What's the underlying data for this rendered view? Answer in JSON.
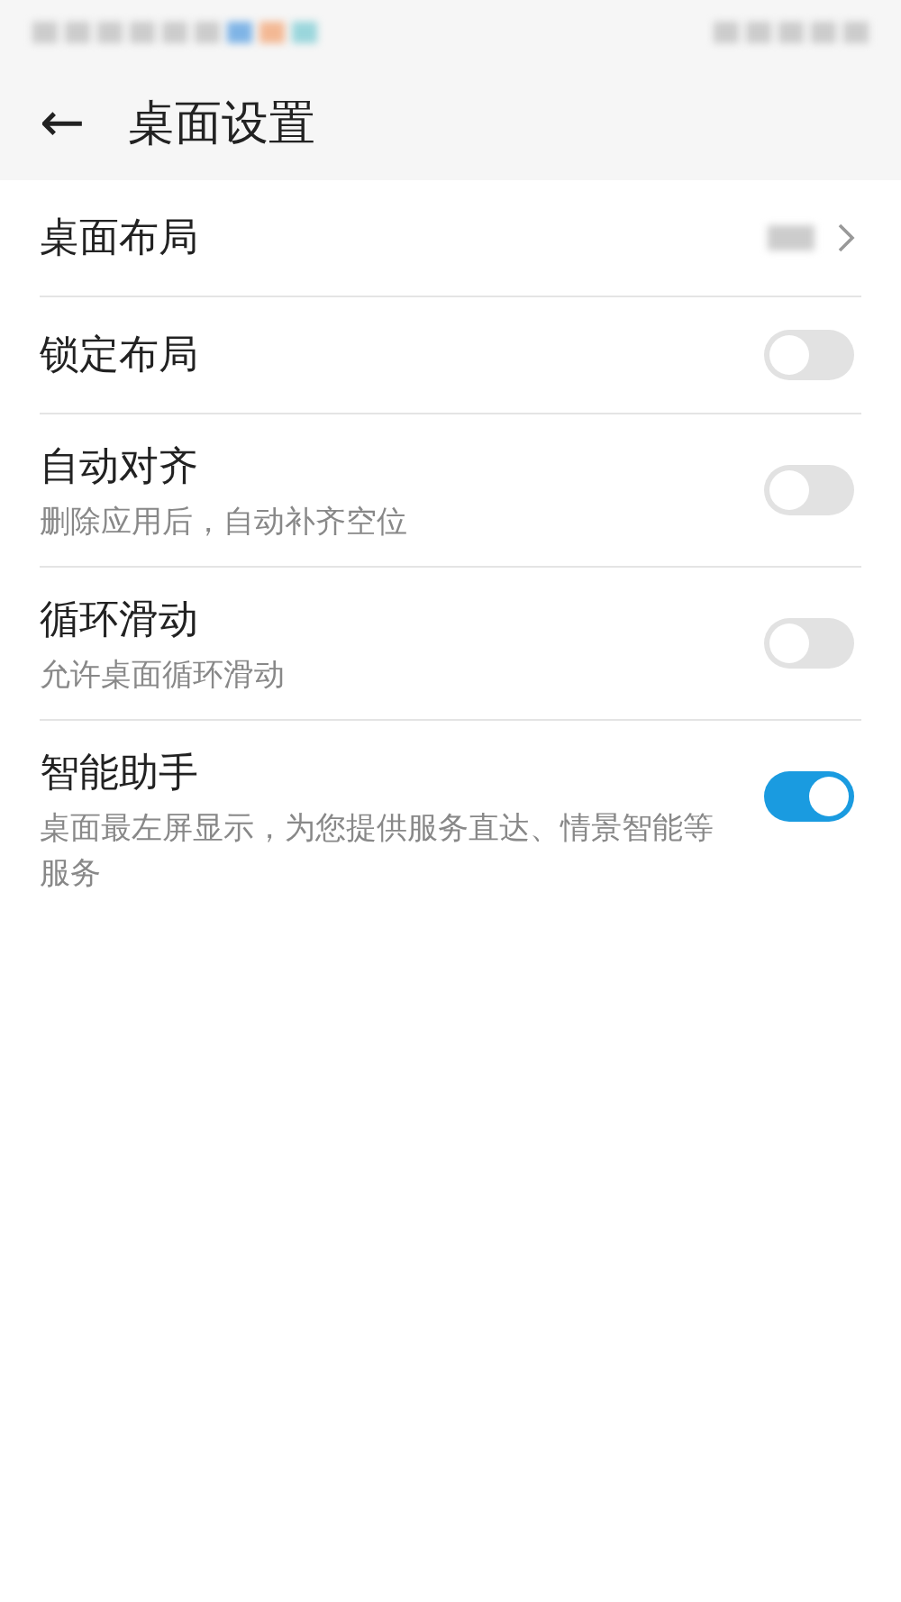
{
  "header": {
    "back_icon": "←",
    "title": "桌面设置"
  },
  "rows": [
    {
      "kind": "link",
      "title": "桌面布局"
    },
    {
      "kind": "switch",
      "title": "锁定布局",
      "on": false
    },
    {
      "kind": "switch",
      "title": "自动对齐",
      "subtitle": "删除应用后，自动补齐空位",
      "on": false
    },
    {
      "kind": "switch",
      "title": "循环滑动",
      "subtitle": "允许桌面循环滑动",
      "on": false
    },
    {
      "kind": "switch",
      "title": "智能助手",
      "subtitle": "桌面最左屏显示，为您提供服务直达、情景智能等服务",
      "on": true
    }
  ]
}
